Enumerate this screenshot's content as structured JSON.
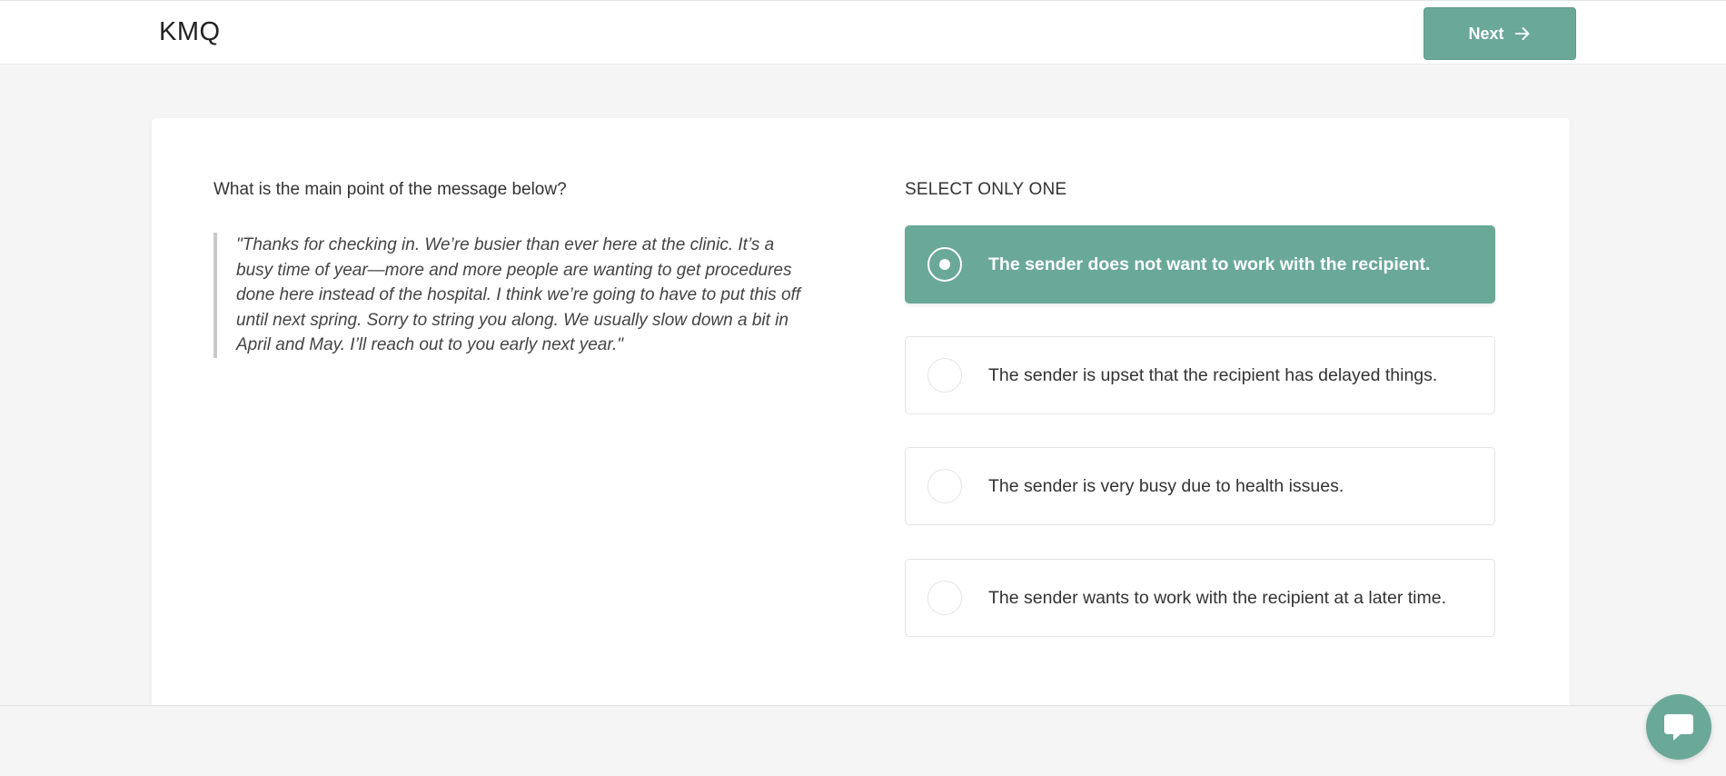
{
  "header": {
    "brand": "KMQ",
    "next_label": "Next"
  },
  "question": {
    "prompt": "What is the main point of the message below?",
    "quote": "\"Thanks for checking in. We’re busier than ever here at the clinic. It’s a busy time of year—more and more people are wanting to get procedures done here instead of the hospital. I think we’re going to have to put this off until next spring. Sorry to string you along. We usually slow down a bit in April and May. I’ll reach out to you early next year.\""
  },
  "answers": {
    "instruction": "SELECT ONLY ONE",
    "options": [
      {
        "label": "The sender does not want to work with the recipient.",
        "selected": true
      },
      {
        "label": "The sender is upset that the recipient has delayed things.",
        "selected": false
      },
      {
        "label": "The sender is very busy due to health issues.",
        "selected": false
      },
      {
        "label": "The sender wants to work with the recipient at a later time.",
        "selected": false
      }
    ]
  },
  "icons": {
    "next": "arrow-right-icon",
    "chat": "chat-bubble-icon"
  },
  "colors": {
    "accent": "#6aa898",
    "page_bg": "#f4f5f4"
  }
}
